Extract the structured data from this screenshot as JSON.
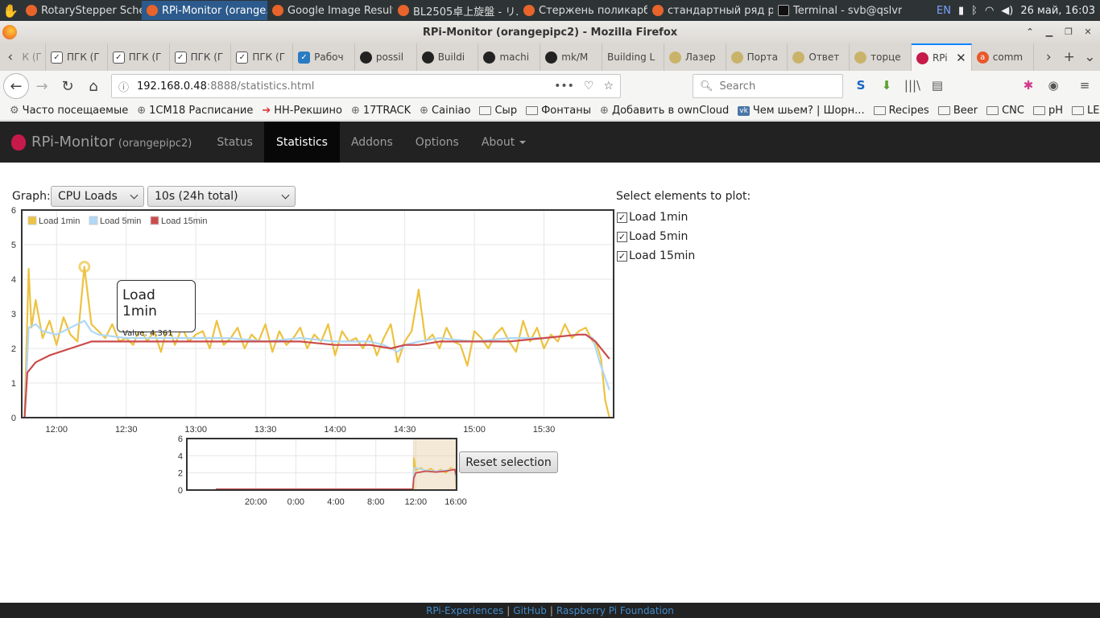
{
  "taskbar": {
    "tasks": [
      {
        "label": "RotaryStepper Sche...",
        "active": false,
        "icon": "firefox-icon"
      },
      {
        "label": "RPi-Monitor (orange...",
        "active": true,
        "icon": "firefox-icon"
      },
      {
        "label": "Google Image Result...",
        "active": false,
        "icon": "firefox-icon"
      },
      {
        "label": "BL2505卓上旋盤 - リ...",
        "active": false,
        "icon": "firefox-icon"
      },
      {
        "label": "Стержень поликарб...",
        "active": false,
        "icon": "firefox-icon"
      },
      {
        "label": "стандартный ряд р...",
        "active": false,
        "icon": "firefox-icon"
      },
      {
        "label": "Terminal - svb@qslvr...",
        "active": false,
        "icon": "terminal-icon"
      }
    ],
    "lang": "EN",
    "clock": "26 май, 16:03"
  },
  "window": {
    "title": "RPi-Monitor (orangepipc2) - Mozilla Firefox"
  },
  "tabs": [
    {
      "label": "ПГК (Г",
      "icon": "checkmark-icon"
    },
    {
      "label": "ПГК (Г",
      "icon": "checkmark-icon"
    },
    {
      "label": "ПГК (Г",
      "icon": "checkmark-icon"
    },
    {
      "label": "ПГК (Г",
      "icon": "checkmark-icon"
    },
    {
      "label": "Рабоч",
      "icon": "checkbox-icon"
    },
    {
      "label": "possil",
      "icon": "github-icon"
    },
    {
      "label": "Buildi",
      "icon": "github-icon"
    },
    {
      "label": "machi",
      "icon": "github-icon"
    },
    {
      "label": "mk/M",
      "icon": "github-icon"
    },
    {
      "label": "Building L",
      "icon": "page-icon"
    },
    {
      "label": "Лазер",
      "icon": "pencil-icon"
    },
    {
      "label": "Порта",
      "icon": "pencil-icon"
    },
    {
      "label": "Ответ",
      "icon": "pencil-icon"
    },
    {
      "label": "торце",
      "icon": "pencil-icon"
    },
    {
      "label": "RPi",
      "icon": "raspberry-icon",
      "active": true
    },
    {
      "label": "comm",
      "icon": "ask-icon"
    }
  ],
  "tab_first_partial": "К (Г",
  "urlbar": {
    "host": "192.168.0.48",
    "rest": ":8888/statistics.html"
  },
  "search": {
    "placeholder": "Search"
  },
  "bookmarks": [
    {
      "label": "Часто посещаемые",
      "icon": "gear-icon"
    },
    {
      "label": "1CM18 Расписание",
      "icon": "globe-icon"
    },
    {
      "label": "НН-Рекшино",
      "icon": "arrow-icon"
    },
    {
      "label": "17TRACK",
      "icon": "globe-icon"
    },
    {
      "label": "Cainiao",
      "icon": "globe-icon"
    },
    {
      "label": "Сыр",
      "icon": "folder-icon"
    },
    {
      "label": "Фонтаны",
      "icon": "folder-icon"
    },
    {
      "label": "Добавить в ownCloud",
      "icon": "globe-icon"
    },
    {
      "label": "Чем шьем? | Шорн...",
      "icon": "vk-icon"
    },
    {
      "label": "Recipes",
      "icon": "folder-icon"
    },
    {
      "label": "Beer",
      "icon": "folder-icon"
    },
    {
      "label": "CNC",
      "icon": "folder-icon"
    },
    {
      "label": "pH",
      "icon": "folder-icon"
    },
    {
      "label": "LED",
      "icon": "folder-icon"
    }
  ],
  "app": {
    "brand": "RPi-Monitor",
    "host": "(orangepipc2)",
    "nav": {
      "status": "Status",
      "statistics": "Statistics",
      "addons": "Addons",
      "options": "Options",
      "about": "About"
    }
  },
  "controls": {
    "graph_label": "Graph:",
    "graph_select": "CPU Loads",
    "range_select": "10s (24h total)",
    "reset_button": "Reset selection",
    "select_title": "Select elements to plot:",
    "checkboxes": [
      {
        "label": "Load 1min",
        "checked": true
      },
      {
        "label": "Load 5min",
        "checked": true
      },
      {
        "label": "Load 15min",
        "checked": true
      }
    ]
  },
  "tooltip": {
    "title": "Load 1min",
    "value": "Value: 4.361"
  },
  "footer": {
    "link1": "RPi-Experiences",
    "sep1": "|",
    "link2": "GitHub",
    "sep2": "|",
    "link3": "Raspberry Pi Foundation"
  },
  "chart_data": [
    {
      "type": "line",
      "xlabel": "",
      "ylabel": "",
      "x_ticks": [
        "12:00",
        "12:30",
        "13:00",
        "13:30",
        "14:00",
        "14:30",
        "15:00",
        "15:30"
      ],
      "x_range_hours": [
        11.75,
        16.0
      ],
      "ylim": [
        0,
        6
      ],
      "y_ticks": [
        0,
        1,
        2,
        3,
        4,
        5,
        6
      ],
      "legend": "top-left",
      "grid": true,
      "series": [
        {
          "name": "Load 1min",
          "color": "#edc240",
          "x": [
            11.77,
            11.8,
            11.82,
            11.85,
            11.9,
            11.95,
            12.0,
            12.05,
            12.1,
            12.15,
            12.2,
            12.25,
            12.3,
            12.35,
            12.4,
            12.45,
            12.5,
            12.55,
            12.6,
            12.65,
            12.7,
            12.75,
            12.8,
            12.85,
            12.9,
            12.95,
            13.0,
            13.05,
            13.1,
            13.15,
            13.2,
            13.25,
            13.3,
            13.35,
            13.4,
            13.45,
            13.5,
            13.55,
            13.6,
            13.65,
            13.7,
            13.75,
            13.8,
            13.85,
            13.9,
            13.95,
            14.0,
            14.05,
            14.1,
            14.15,
            14.2,
            14.25,
            14.3,
            14.35,
            14.4,
            14.45,
            14.5,
            14.55,
            14.6,
            14.65,
            14.7,
            14.75,
            14.8,
            14.85,
            14.9,
            14.95,
            15.0,
            15.05,
            15.1,
            15.15,
            15.2,
            15.25,
            15.3,
            15.35,
            15.4,
            15.45,
            15.5,
            15.55,
            15.6,
            15.65,
            15.7,
            15.75,
            15.8,
            15.85,
            15.88,
            15.91,
            15.94,
            15.97
          ],
          "y": [
            0,
            4.3,
            2.6,
            3.4,
            2.3,
            2.8,
            2.1,
            2.9,
            2.4,
            2.2,
            4.36,
            2.7,
            2.5,
            2.3,
            2.7,
            2.2,
            2.3,
            2.1,
            2.6,
            2.2,
            2.5,
            1.9,
            2.7,
            2.1,
            2.6,
            2.2,
            2.4,
            2.5,
            2.0,
            2.8,
            2.1,
            2.3,
            2.6,
            2.0,
            2.4,
            2.2,
            2.7,
            1.9,
            2.5,
            2.1,
            2.3,
            2.6,
            2.0,
            2.4,
            2.2,
            2.7,
            1.8,
            2.5,
            2.2,
            2.3,
            2.0,
            2.4,
            1.8,
            2.3,
            2.7,
            1.6,
            2.2,
            2.5,
            3.7,
            2.2,
            2.4,
            2.0,
            2.6,
            2.2,
            2.1,
            1.5,
            2.5,
            2.3,
            2.0,
            2.4,
            2.6,
            2.2,
            1.9,
            2.8,
            2.2,
            2.6,
            2.0,
            2.4,
            2.2,
            2.7,
            2.3,
            2.5,
            2.6,
            2.2,
            2.1,
            1.7,
            0.5,
            0
          ]
        },
        {
          "name": "Load 5min",
          "color": "#afd8f8",
          "x": [
            11.77,
            11.8,
            11.85,
            11.9,
            12.0,
            12.1,
            12.2,
            12.25,
            12.3,
            12.5,
            12.75,
            13.0,
            13.25,
            13.5,
            13.75,
            14.0,
            14.25,
            14.35,
            14.45,
            14.5,
            14.6,
            14.75,
            15.0,
            15.25,
            15.5,
            15.75,
            15.8,
            15.85,
            15.9,
            15.97
          ],
          "y": [
            0,
            2.6,
            2.7,
            2.5,
            2.4,
            2.6,
            2.8,
            2.5,
            2.4,
            2.3,
            2.3,
            2.3,
            2.3,
            2.2,
            2.3,
            2.2,
            2.2,
            2.1,
            1.9,
            2.1,
            2.2,
            2.3,
            2.2,
            2.3,
            2.3,
            2.4,
            2.4,
            2.3,
            1.6,
            0.8
          ]
        },
        {
          "name": "Load 15min",
          "color": "#cb4b4b",
          "x": [
            11.77,
            11.79,
            11.85,
            11.95,
            12.1,
            12.25,
            12.4,
            12.6,
            12.8,
            13.0,
            13.25,
            13.5,
            13.75,
            14.0,
            14.25,
            14.4,
            14.5,
            14.6,
            14.75,
            15.0,
            15.25,
            15.5,
            15.75,
            15.8,
            15.87,
            15.97
          ],
          "y": [
            0,
            1.3,
            1.6,
            1.8,
            2.0,
            2.2,
            2.2,
            2.2,
            2.2,
            2.2,
            2.2,
            2.2,
            2.2,
            2.1,
            2.1,
            2.0,
            2.1,
            2.1,
            2.2,
            2.2,
            2.2,
            2.3,
            2.4,
            2.4,
            2.2,
            1.7
          ]
        }
      ]
    },
    {
      "type": "line",
      "xlabel": "",
      "ylabel": "",
      "x_ticks": [
        "20:00",
        "0:00",
        "4:00",
        "8:00",
        "12:00",
        "16:00"
      ],
      "ylim": [
        0,
        6
      ],
      "y_ticks": [
        0,
        2,
        4,
        6
      ],
      "selection": [
        "11:45",
        "16:03"
      ],
      "series": [
        {
          "name": "Load 1min",
          "color": "#edc240",
          "x": [
            -8,
            11.7,
            11.77,
            11.8,
            12,
            12.5,
            13,
            13.5,
            14,
            14.5,
            15,
            15.5,
            15.9,
            16.05
          ],
          "y": [
            0,
            0,
            0,
            3.8,
            2.3,
            2.6,
            2.2,
            2.5,
            2.1,
            2.4,
            2.0,
            2.6,
            2.3,
            0.3
          ]
        },
        {
          "name": "Load 5min",
          "color": "#afd8f8",
          "x": [
            -8,
            11.7,
            11.8,
            12,
            13,
            14,
            15,
            15.9,
            16.05
          ],
          "y": [
            0,
            0,
            2.5,
            2.6,
            2.3,
            2.2,
            2.3,
            2.4,
            0.8
          ]
        },
        {
          "name": "Load 15min",
          "color": "#cb4b4b",
          "x": [
            -8,
            11.7,
            11.8,
            12,
            13,
            14,
            15,
            15.9,
            16.05
          ],
          "y": [
            0.1,
            0.1,
            1.4,
            2.0,
            2.2,
            2.1,
            2.2,
            2.4,
            1.7
          ]
        }
      ]
    }
  ]
}
